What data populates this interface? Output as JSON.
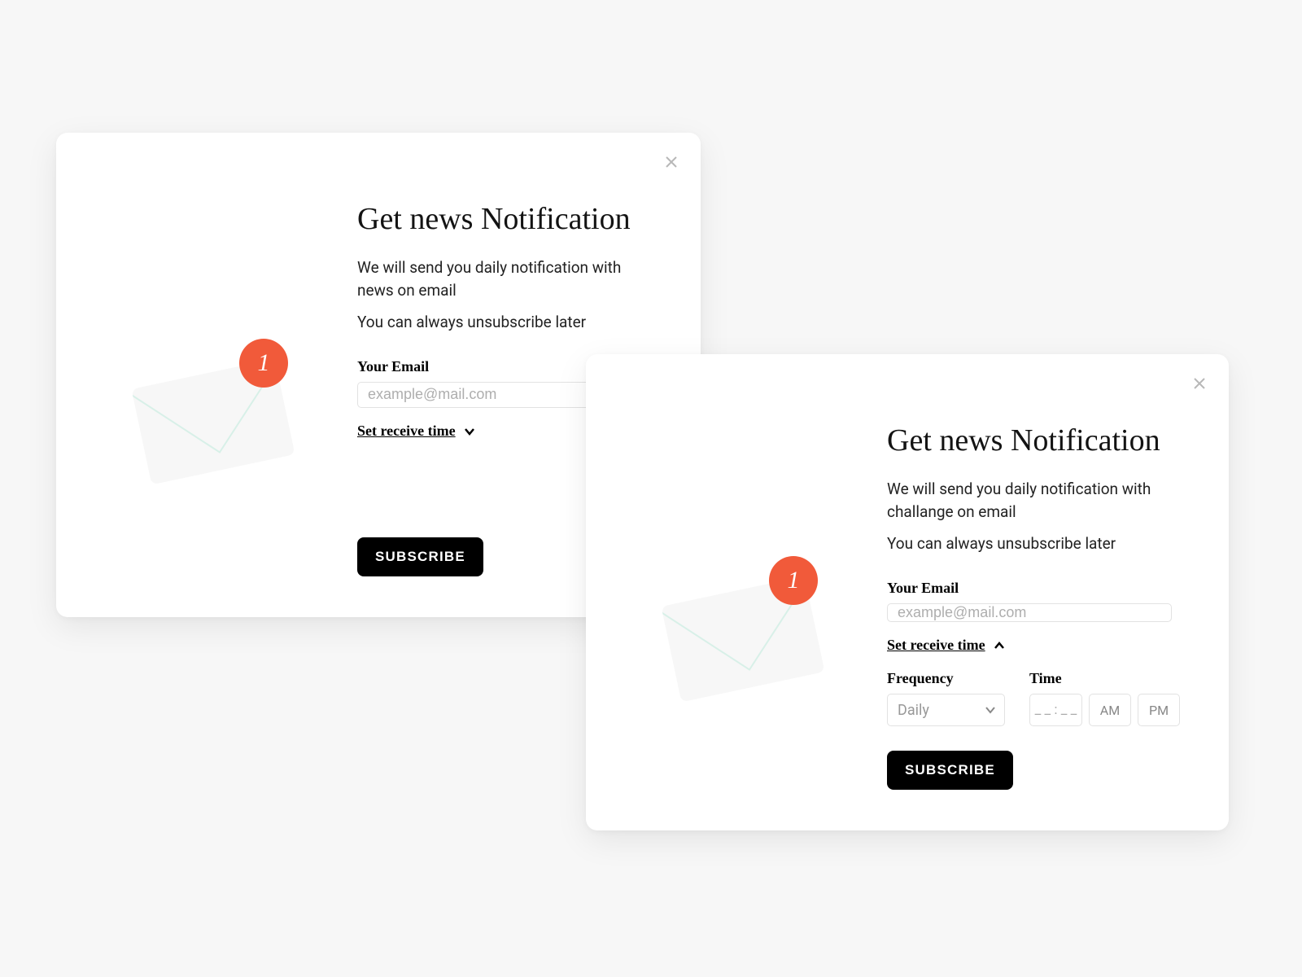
{
  "colors": {
    "accent": "#f15a3a"
  },
  "modal1": {
    "title": "Get news Notification",
    "desc1": "We will send you daily notification with news on email",
    "desc2": "You can always unsubscribe later",
    "email_label": "Your Email",
    "email_placeholder": "example@mail.com",
    "email_value": "",
    "toggle_label": "Set receive time",
    "toggle_open": false,
    "subscribe_label": "SUBSCRIBE",
    "badge_count": "1"
  },
  "modal2": {
    "title": "Get news Notification",
    "desc1": "We will send you daily notification with challange on email",
    "desc2": "You can always unsubscribe later",
    "email_label": "Your Email",
    "email_placeholder": "example@mail.com",
    "email_value": "",
    "toggle_label": "Set receive time",
    "toggle_open": true,
    "frequency_label": "Frequency",
    "frequency_value": "Daily",
    "time_label": "Time",
    "time_value": "_ _ : _ _",
    "am_label": "AM",
    "pm_label": "PM",
    "subscribe_label": "SUBSCRIBE",
    "badge_count": "1"
  }
}
